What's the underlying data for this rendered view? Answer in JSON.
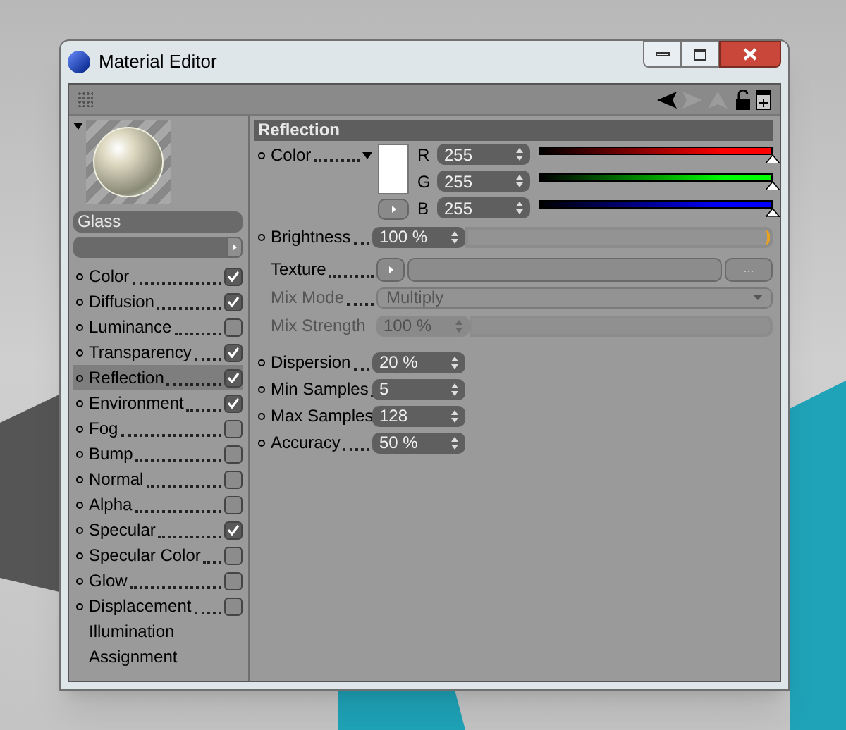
{
  "window": {
    "title": "Material Editor"
  },
  "material": {
    "name": "Glass"
  },
  "channels": [
    {
      "name": "Color",
      "kind": "check",
      "checked": true,
      "selected": false
    },
    {
      "name": "Diffusion",
      "kind": "check",
      "checked": true,
      "selected": false
    },
    {
      "name": "Luminance",
      "kind": "check",
      "checked": false,
      "selected": false
    },
    {
      "name": "Transparency",
      "kind": "check",
      "checked": true,
      "selected": false
    },
    {
      "name": "Reflection",
      "kind": "check",
      "checked": true,
      "selected": true
    },
    {
      "name": "Environment",
      "kind": "check",
      "checked": true,
      "selected": false
    },
    {
      "name": "Fog",
      "kind": "check",
      "checked": false,
      "selected": false
    },
    {
      "name": "Bump",
      "kind": "check",
      "checked": false,
      "selected": false
    },
    {
      "name": "Normal",
      "kind": "check",
      "checked": false,
      "selected": false
    },
    {
      "name": "Alpha",
      "kind": "check",
      "checked": false,
      "selected": false
    },
    {
      "name": "Specular",
      "kind": "check",
      "checked": true,
      "selected": false
    },
    {
      "name": "Specular Color",
      "kind": "check",
      "checked": false,
      "selected": false
    },
    {
      "name": "Glow",
      "kind": "check",
      "checked": false,
      "selected": false
    },
    {
      "name": "Displacement",
      "kind": "check",
      "checked": false,
      "selected": false
    },
    {
      "name": "Illumination",
      "kind": "plain",
      "selected": false
    },
    {
      "name": "Assignment",
      "kind": "plain",
      "selected": false
    }
  ],
  "section": {
    "title": "Reflection"
  },
  "color": {
    "label": "Color",
    "channels": [
      {
        "letter": "R",
        "value": "255",
        "level": 1,
        "color": "#ff0000"
      },
      {
        "letter": "G",
        "value": "255",
        "level": 1,
        "color": "#00ff00"
      },
      {
        "letter": "B",
        "value": "255",
        "level": 1,
        "color": "#0000ff"
      }
    ]
  },
  "brightness": {
    "label": "Brightness",
    "value": "100 %",
    "level": 1
  },
  "texture": {
    "label": "Texture",
    "browse": "..."
  },
  "mix_mode": {
    "label": "Mix Mode",
    "value": "Multiply",
    "disabled": true
  },
  "mix_strength": {
    "label": "Mix Strength",
    "value": "100 %",
    "disabled": true,
    "level": 1
  },
  "params": [
    {
      "label": "Dispersion",
      "value": "20 %"
    },
    {
      "label": "Min Samples",
      "value": "5"
    },
    {
      "label": "Max Samples",
      "value": "128"
    },
    {
      "label": "Accuracy",
      "value": "50 %"
    }
  ]
}
